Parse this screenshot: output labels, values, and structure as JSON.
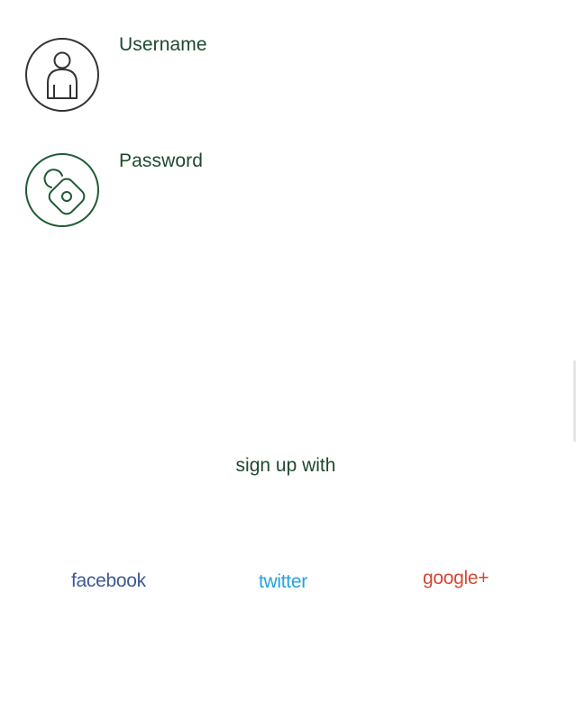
{
  "form": {
    "username_label": "Username",
    "password_label": "Password"
  },
  "signup": {
    "label": "sign up with",
    "providers": {
      "facebook": "facebook",
      "twitter": "twitter",
      "google": "google+"
    }
  },
  "icons": {
    "username": "user-icon",
    "password": "lock-icon"
  },
  "colors": {
    "text_green": "#1d4a2c",
    "icon_green": "#1d5a33",
    "icon_gray": "#333333",
    "facebook": "#3b5896",
    "twitter": "#26a1dd",
    "google": "#d34836"
  }
}
